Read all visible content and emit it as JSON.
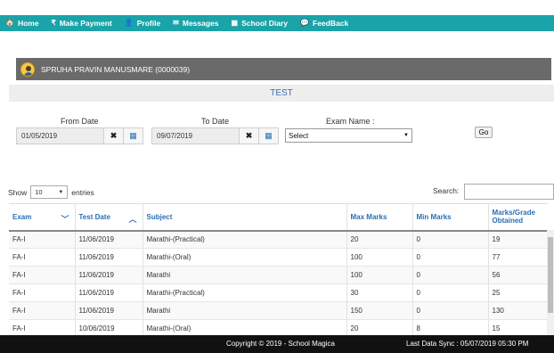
{
  "nav": {
    "items": [
      {
        "label": "Home",
        "icon": "home-icon",
        "glyph": "🏠"
      },
      {
        "label": "Make Payment",
        "icon": "rupee-icon",
        "glyph": "₹"
      },
      {
        "label": "Profile",
        "icon": "user-icon",
        "glyph": "👤"
      },
      {
        "label": "Messages",
        "icon": "envelope-icon",
        "glyph": "✉"
      },
      {
        "label": "School Diary",
        "icon": "calendar-icon",
        "glyph": "▦"
      },
      {
        "label": "FeedBack",
        "icon": "chat-icon",
        "glyph": "💬"
      }
    ]
  },
  "user": {
    "name": "SPRUHA PRAVIN MANUSMARE (0000039)"
  },
  "page": {
    "title": "TEST"
  },
  "filters": {
    "from_label": "From Date",
    "from_value": "01/05/2019",
    "to_label": "To Date",
    "to_value": "09/07/2019",
    "exam_label": "Exam Name :",
    "exam_value": "Select",
    "go_label": "Go"
  },
  "table_controls": {
    "show_label": "Show",
    "entries_value": "10",
    "entries_label": "entries",
    "search_label": "Search:"
  },
  "table": {
    "headers": [
      "Exam",
      "Test Date",
      "Subject",
      "Max Marks",
      "Min Marks",
      "Marks/Grade Obtained"
    ],
    "rows": [
      [
        "FA-I",
        "11/06/2019",
        "Marathi-(Practical)",
        "20",
        "0",
        "19"
      ],
      [
        "FA-I",
        "11/06/2019",
        "Marathi-(Oral)",
        "100",
        "0",
        "77"
      ],
      [
        "FA-I",
        "11/06/2019",
        "Marathi",
        "100",
        "0",
        "56"
      ],
      [
        "FA-I",
        "11/06/2019",
        "Marathi-(Practical)",
        "30",
        "0",
        "25"
      ],
      [
        "FA-I",
        "11/06/2019",
        "Marathi",
        "150",
        "0",
        "130"
      ],
      [
        "FA-I",
        "10/06/2019",
        "Marathi-(Oral)",
        "20",
        "8",
        "15"
      ]
    ]
  },
  "footer": {
    "copyright": "Copyright © 2019 - School Magica",
    "sync": "Last Data Sync : 05/07/2019 05:30 PM"
  }
}
